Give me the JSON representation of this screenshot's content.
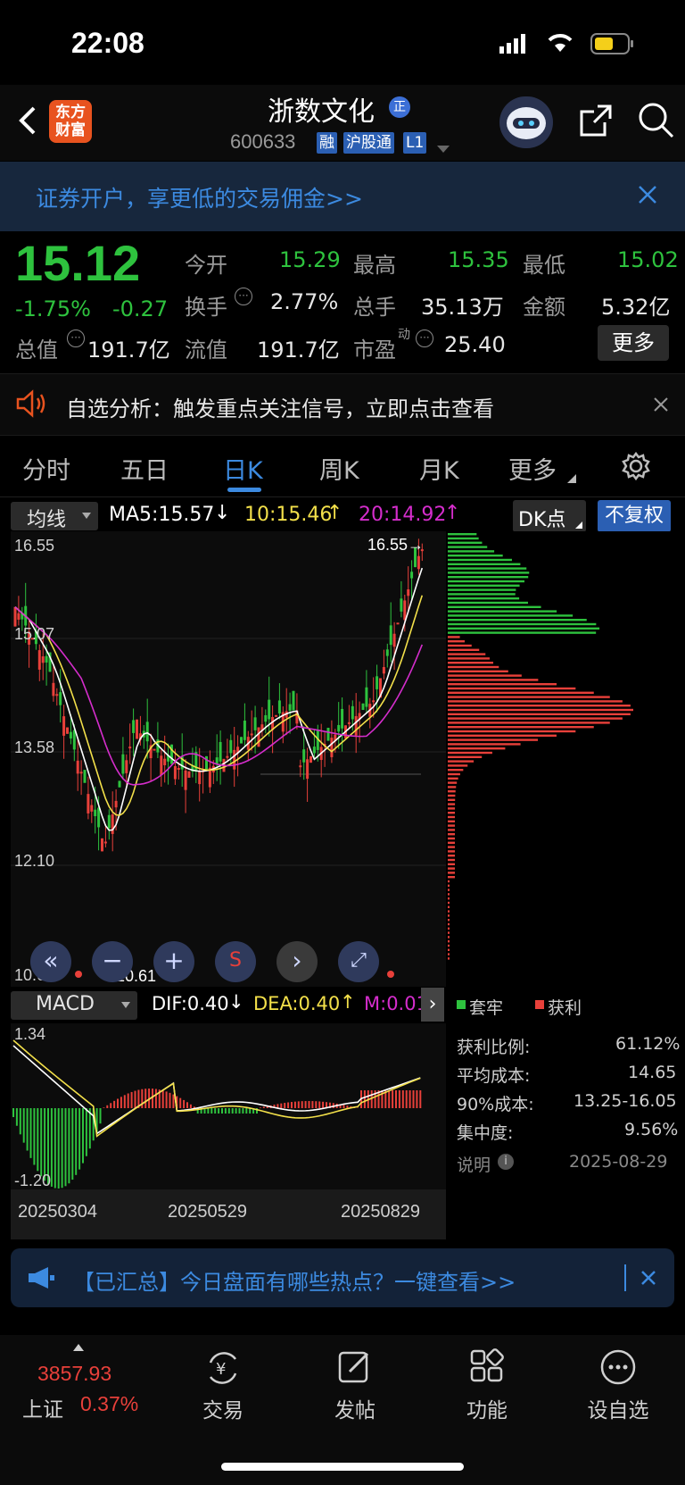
{
  "status_bar": {
    "time": "22:08"
  },
  "header": {
    "logo": [
      "东方",
      "财富"
    ],
    "stock_name": "浙数文化",
    "stock_code": "600633",
    "tags": [
      "融",
      "沪股通",
      "L1"
    ]
  },
  "promo_banner": {
    "text": "证券开户，享更低的交易佣金>>"
  },
  "quote": {
    "price": "15.12",
    "change_pct": "-1.75%",
    "change": "-0.27",
    "open_label": "今开",
    "open": "15.29",
    "high_label": "最高",
    "high": "15.35",
    "low_label": "最低",
    "low": "15.02",
    "turnover_label": "换手",
    "turnover": "2.77%",
    "volume_label": "总手",
    "volume": "35.13万",
    "amount_label": "金额",
    "amount": "5.32亿",
    "mktcap_label": "总值",
    "mktcap": "191.7亿",
    "float_label": "流值",
    "float": "191.7亿",
    "pe_label": "市盈",
    "pe_sup": "动",
    "pe": "25.40",
    "more": "更多"
  },
  "notice": {
    "text": "自选分析：触发重点关注信号，立即点击查看"
  },
  "tabs": [
    "分时",
    "五日",
    "日K",
    "周K",
    "月K",
    "更多"
  ],
  "active_tab": "日K",
  "ma_bar": {
    "selector": "均线",
    "ma5": "MA5:15.57",
    "ma10": "10:15.46",
    "ma20": "20:14.92",
    "dk": "DK点",
    "adjust": "不复权"
  },
  "chart_data": {
    "type": "candlestick",
    "y_ticks": [
      "16.55",
      "15.07",
      "13.58",
      "12.10",
      "10.61"
    ],
    "ylim": [
      10.61,
      16.55
    ],
    "high_marker": "16.55→",
    "low_marker": "←10.61",
    "x_labels": [
      "20250304",
      "20250529",
      "20250829"
    ],
    "macd": {
      "selector": "MACD",
      "dif": "DIF:0.40",
      "dea": "DEA:0.40",
      "m": "M:0.01",
      "y_top": "1.34",
      "y_bottom": "-1.20"
    }
  },
  "chip_panel": {
    "legend_hold": "套牢",
    "legend_profit": "获利",
    "rows": [
      {
        "label": "获利比例:",
        "value": "61.12%"
      },
      {
        "label": "平均成本:",
        "value": "14.65"
      },
      {
        "label": "90%成本:",
        "value": "13.25-16.05"
      },
      {
        "label": "集中度:",
        "value": "9.56%"
      }
    ],
    "note_label": "说明",
    "date": "2025-08-29"
  },
  "bottom_banner": {
    "text": "【已汇总】今日盘面有哪些热点？一键查看>>"
  },
  "bottom_nav": {
    "index_value": "3857.93",
    "index_name": "上证",
    "index_pct": "0.37%",
    "items": [
      "交易",
      "发帖",
      "功能",
      "设自选"
    ]
  },
  "colors": {
    "up": "#e8403a",
    "down": "#2ec23e",
    "accent": "#3c8ae0"
  }
}
